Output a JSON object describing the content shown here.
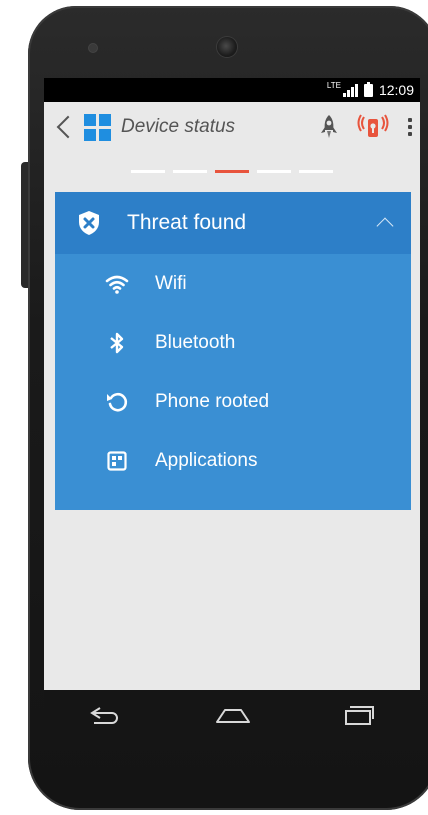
{
  "status_bar": {
    "network": "LTE",
    "time": "12:09"
  },
  "action_bar": {
    "title": "Device status",
    "icons": [
      "back-icon",
      "app-logo-icon",
      "rocket-icon",
      "phone-alarm-icon",
      "overflow-menu-icon"
    ]
  },
  "pager": {
    "count": 5,
    "active_index": 2
  },
  "threat_card": {
    "title": "Threat found",
    "items": [
      {
        "label": "Wifi",
        "icon": "wifi-icon"
      },
      {
        "label": "Bluetooth",
        "icon": "bluetooth-icon"
      },
      {
        "label": "Phone rooted",
        "icon": "rotate-icon"
      },
      {
        "label": "Applications",
        "icon": "apps-icon"
      }
    ]
  },
  "navigation": [
    "back-nav-icon",
    "home-nav-icon",
    "recents-nav-icon"
  ],
  "colors": {
    "accent_blue": "#3a8fd3",
    "header_blue": "#2d7fc8",
    "active_indicator": "#e8543d",
    "alarm_red": "#e8543d"
  }
}
